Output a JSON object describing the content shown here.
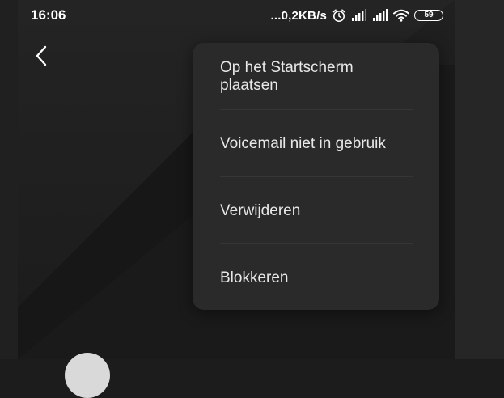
{
  "status_bar": {
    "time": "16:06",
    "net_speed": "...0,2KB/s",
    "battery_level": "59",
    "icons": [
      "alarm-icon",
      "signal-icon",
      "signal-icon",
      "wifi-icon",
      "battery-icon"
    ]
  },
  "header": {
    "back_icon": "chevron-left-icon"
  },
  "menu": {
    "items": [
      {
        "label": "Op het Startscherm plaatsen"
      },
      {
        "label": "Voicemail niet in gebruik"
      },
      {
        "label": "Verwijderen"
      },
      {
        "label": "Blokkeren"
      }
    ]
  },
  "colors": {
    "background": "#1c1c1c",
    "menu_background": "#2a2a2a",
    "menu_text": "#e8e8e8",
    "divider": "#363636",
    "status_text": "#ffffff"
  }
}
